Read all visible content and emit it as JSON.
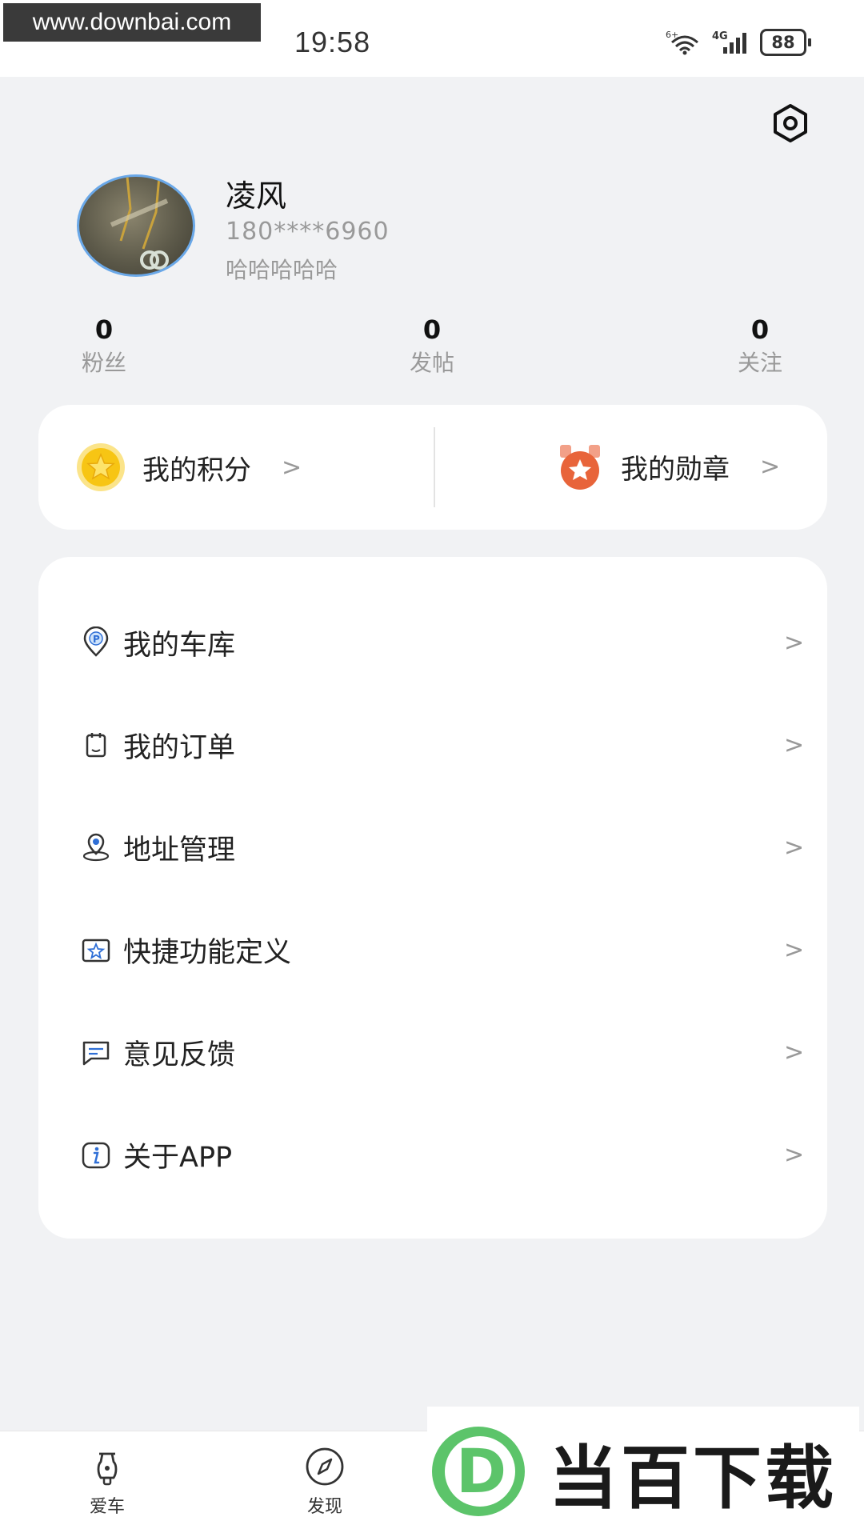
{
  "status_bar": {
    "watermark": "www.downbai.com",
    "time": "19:58",
    "network": "4G",
    "battery": "88"
  },
  "profile": {
    "name": "凌风",
    "phone": "180****6960",
    "bio": "哈哈哈哈哈"
  },
  "stats": [
    {
      "value": "0",
      "label": "粉丝"
    },
    {
      "value": "0",
      "label": "发帖"
    },
    {
      "value": "0",
      "label": "关注"
    }
  ],
  "points_card": {
    "points_label": "我的积分",
    "medal_label": "我的勋章"
  },
  "menu": [
    {
      "label": "我的车库",
      "icon": "parking-pin-icon"
    },
    {
      "label": "我的订单",
      "icon": "order-icon"
    },
    {
      "label": "地址管理",
      "icon": "location-icon"
    },
    {
      "label": "快捷功能定义",
      "icon": "shortcut-star-icon"
    },
    {
      "label": "意见反馈",
      "icon": "feedback-icon"
    },
    {
      "label": "关于APP",
      "icon": "info-icon"
    }
  ],
  "bottom_nav": [
    {
      "label": "爱车",
      "icon": "scooter-icon"
    },
    {
      "label": "发现",
      "icon": "compass-icon"
    }
  ],
  "watermark_brand": {
    "text": "当百下载",
    "logo_letter": "D"
  },
  "colors": {
    "background": "#f1f2f4",
    "card": "#ffffff",
    "coin": "#f7c514",
    "medal": "#e8643a",
    "brand_green": "#5cc46a"
  }
}
